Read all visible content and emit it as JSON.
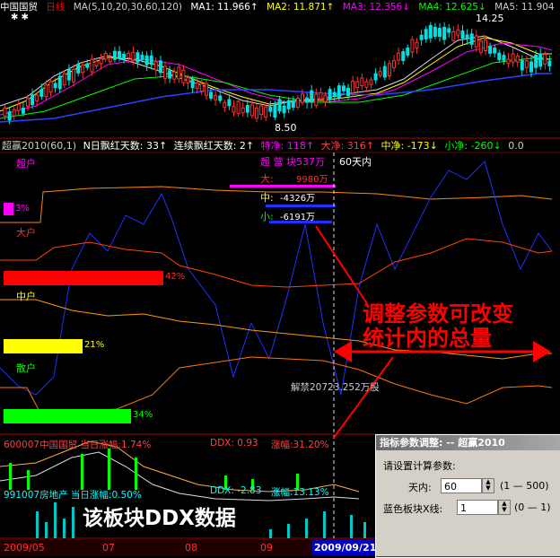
{
  "header": {
    "stock_name": "中国国贸",
    "period": "日线",
    "ma_params": "MA(5,10,20,30,60,120)",
    "ma1": "MA1: 11.966↑",
    "ma2": "MA2: 11.871↑",
    "ma3": "MA3: 12.356↓",
    "ma4": "MA4: 12.625↓",
    "ma5": "MA5: 11.904"
  },
  "price_chart": {
    "high_label": "14.25",
    "low_label": "8.50"
  },
  "indicator_header": {
    "name": "超赢2010(60,1)",
    "n_days": "N日飘红天数: 33↑",
    "consecutive": "连续飘红天数: 2↑",
    "tejing": "特净: 118↑",
    "dajing": "大净: 316↑",
    "zhongjing": "中净: -173↓",
    "xiaojing": "小净: -260↓",
    "tail": "0.0"
  },
  "sections": {
    "super": {
      "label": "超户",
      "percent": "3%"
    },
    "large": {
      "label": "大户",
      "percent": "42%"
    },
    "medium": {
      "label": "中户",
      "percent": "21%"
    },
    "retail": {
      "label": "散户",
      "percent": "34%"
    }
  },
  "stats_overlay": {
    "title": "超 营 块537万",
    "window": "60天内",
    "da": "大:",
    "da_value": "9980万",
    "zhong": "中:",
    "zhong_value": "-4326万",
    "xiao": "小:",
    "xiao_value": "-6191万"
  },
  "annotation": {
    "line1": "调整参数可改变",
    "line2": "统计内的总量",
    "unlock": "解禁20723.252万股"
  },
  "ddx_panel": {
    "line1": "600007中国国贸 当日涨幅:1.74%",
    "ddx1": "DDX: 0.93",
    "zf1": "涨幅:31.20%",
    "line2": "991007房地产 当日涨幅:0.50%",
    "ddx2": "DDX: -2.83",
    "zf2": "涨幅:13.13%",
    "big_label": "该板块DDX数据"
  },
  "dates": {
    "d1": "2009/05",
    "d2": "07",
    "d3": "08",
    "d4": "09",
    "current": "2009/09/21"
  },
  "dialog": {
    "title": "指标参数调整: -- 超赢2010",
    "prompt": "请设置计算参数:",
    "days_label": "天内:",
    "days_value": "60",
    "days_range": "(1 — 500)",
    "line_label": "蓝色板块X线:",
    "line_value": "1",
    "line_range": "(0 — 1)"
  },
  "colors": {
    "magenta": "#ff00ff",
    "red": "#ff0000",
    "yellow": "#ffff00",
    "green": "#00ff00",
    "cyan": "#00ffff",
    "white": "#ffffff",
    "blue": "#2030ff"
  }
}
